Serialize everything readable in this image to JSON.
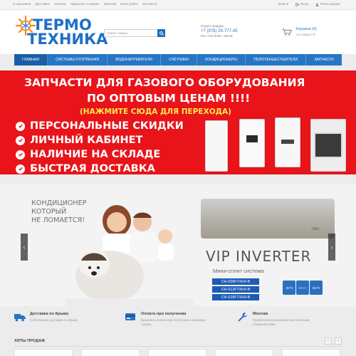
{
  "topbar": {
    "links": [
      "О магазине",
      "Доставка",
      "Оплата",
      "Гарантия и сервис",
      "Монтаж",
      "Фото работ",
      "Контакты"
    ],
    "currency": "RUB",
    "login": "Вход",
    "register": "Регистрация"
  },
  "header": {
    "logo_line1": "ТЕРМО",
    "logo_line2": "ТЕХНИКА",
    "search_placeholder": "Найти товары",
    "contact_label": "Отдел продаж:",
    "phone": "+7 (978) 25-777-45",
    "hours": "Пн—Сб 9:00—18:00",
    "cart_title": "Корзина (0)",
    "cart_sum": "на сумму 0 ₽"
  },
  "nav": {
    "items": [
      "ГЛАВНАЯ",
      "СИСТЕМЫ ОТОПЛЕНИЯ",
      "ВОДОНАГРЕВАТЕЛИ",
      "СЧЁТЧИКИ",
      "КОНДИЦИОНЕРЫ",
      "ПОЛОТЕНЦЕСУШИТЕЛИ",
      "ЗАПЧАСТИ"
    ]
  },
  "promo": {
    "line1": "ЗАПЧАСТИ ДЛЯ ГАЗОВОГО ОБОРУДОВАНИЯ",
    "line2": "ПО ОПТОВЫМ ЦЕНАМ !!!!",
    "line3": "(НАЖМИТЕ СЮДА ДЛЯ ПЕРЕХОДА)",
    "bullets": [
      "ПЕРСОНАЛЬНЫЕ СКИДКИ",
      "ЛИЧНЫЙ КАБИНЕТ",
      "НАЛИЧИЕ НА СКЛАДЕ",
      "БЫСТРАЯ ДОСТАВКА"
    ],
    "colors": {
      "background": "#e8141a",
      "accent": "#ffe94a"
    }
  },
  "slider": {
    "tagline": [
      "КОНДИЦИОНЕР",
      "КОТОРЫЙ",
      "НЕ ЛОМАЕТСЯ!"
    ],
    "headline": "VIP INVERTER",
    "subtitle": "Мини-сплит система",
    "models": [
      "CH-S09FTXHV-B",
      "CH-S12FTXHV-B",
      "CH-S18FTXHV-B"
    ],
    "badges": [
      "-30°C",
      "A+++",
      "Wi-Fi"
    ],
    "brand": "C&H",
    "prev_icon": "chevron-left-icon",
    "next_icon": "chevron-right-icon"
  },
  "features": [
    {
      "icon": "truck-icon",
      "title": "Доставка по Крыму",
      "desc": [
        "Собственная доставка по Крыму"
      ]
    },
    {
      "icon": "card-icon",
      "title": "Оплата при получении",
      "desc": [
        "Возможна оплата при получении и проверке",
        "товара"
      ]
    },
    {
      "icon": "wrench-icon",
      "title": "Монтаж",
      "desc": [
        "Профессиональный монтаж опытными",
        "специалистами"
      ]
    }
  ],
  "hits": {
    "title": "ХИТЫ ПРОДАЖ"
  }
}
